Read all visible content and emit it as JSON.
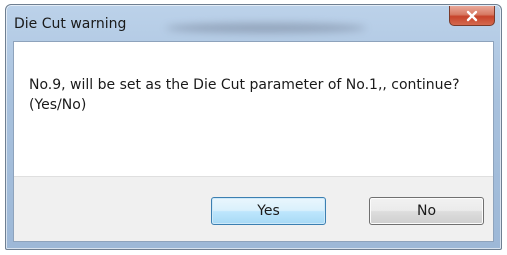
{
  "window": {
    "title": "Die Cut warning"
  },
  "message": {
    "text": "No.9, will be set as the Die Cut parameter of No.1,, continue? (Yes/No)"
  },
  "buttons": {
    "yes_label": "Yes",
    "no_label": "No"
  },
  "icons": {
    "close": "close-icon"
  },
  "colors": {
    "close_button": "#c7432a",
    "default_button_border": "#3c7fb1",
    "footer_background": "#f0f0f0"
  }
}
